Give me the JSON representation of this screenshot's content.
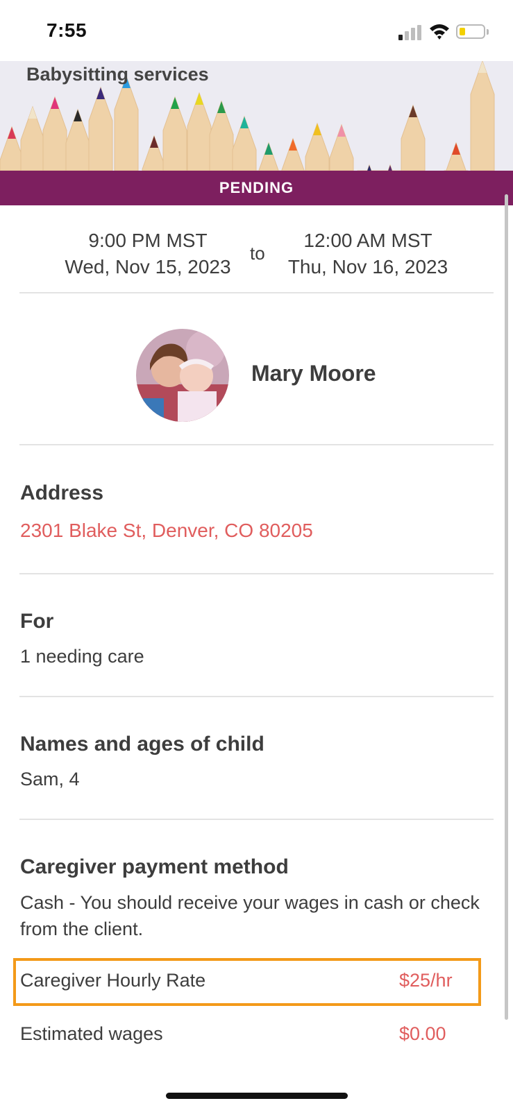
{
  "status_bar": {
    "time": "7:55"
  },
  "header": {
    "title": "Babysitting services",
    "status": "PENDING",
    "status_color": "#7d1f5f"
  },
  "schedule": {
    "start_time": "9:00 PM MST",
    "start_date": "Wed, Nov 15, 2023",
    "to_word": "to",
    "end_time": "12:00 AM MST",
    "end_date": "Thu, Nov 16, 2023"
  },
  "client": {
    "name": "Mary Moore"
  },
  "address": {
    "label": "Address",
    "value": "2301 Blake St, Denver, CO 80205",
    "link_color": "#e05d5d"
  },
  "for": {
    "label": "For",
    "value": "1 needing care"
  },
  "children": {
    "label": "Names and ages of child",
    "value": "Sam, 4"
  },
  "payment": {
    "label": "Caregiver payment method",
    "value": "Cash - You should receive your wages in cash or check from the client."
  },
  "rate": {
    "label": "Caregiver Hourly Rate",
    "value": "$25/hr",
    "highlight_color": "#f39a19"
  },
  "wages": {
    "label": "Estimated wages",
    "value": "$0.00"
  },
  "icons": [
    "cellular-signal-icon",
    "wifi-icon",
    "battery-icon"
  ]
}
